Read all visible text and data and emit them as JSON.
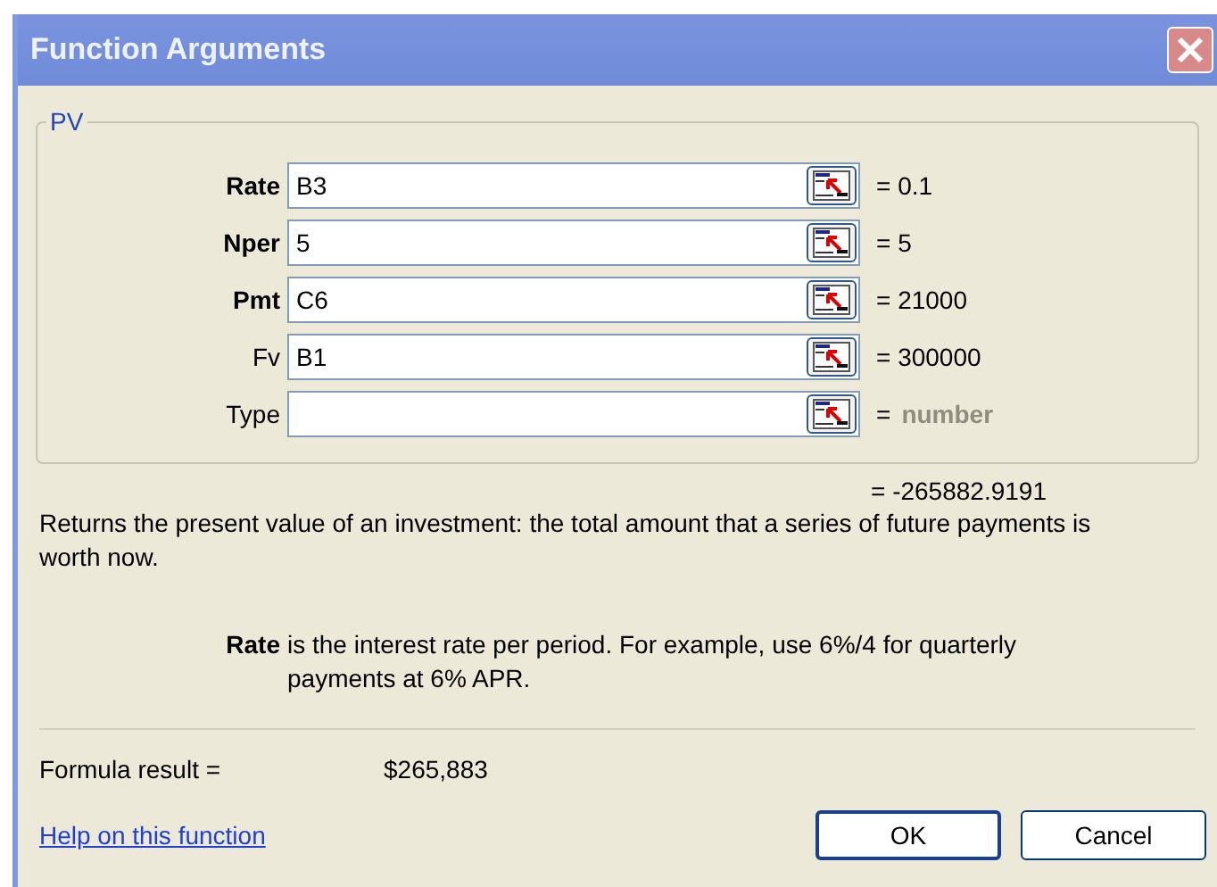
{
  "window": {
    "title": "Function Arguments"
  },
  "function": {
    "name": "PV",
    "arguments": [
      {
        "name": "Rate",
        "required": true,
        "value": "B3",
        "result": "= 0.1",
        "result_greyed": false
      },
      {
        "name": "Nper",
        "required": true,
        "value": "5",
        "result": "= 5",
        "result_greyed": false
      },
      {
        "name": "Pmt",
        "required": true,
        "value": "C6",
        "result": "= 21000",
        "result_greyed": false
      },
      {
        "name": "Fv",
        "required": false,
        "value": "B1",
        "result": "= 300000",
        "result_greyed": false
      },
      {
        "name": "Type",
        "required": false,
        "result_equals": "=",
        "result": "number",
        "result_greyed": true
      }
    ],
    "result": "= -265882.9191",
    "description": "Returns the present value of an investment: the total amount that a series of future payments is worth now.",
    "argument_help": {
      "name": "Rate",
      "text": "is the interest rate per period. For example, use 6%/4 for quarterly payments at 6% APR."
    }
  },
  "formula_result": {
    "label": "Formula result =",
    "value": "$265,883"
  },
  "help_link": "Help on this function",
  "buttons": [
    "OK",
    "Cancel"
  ]
}
